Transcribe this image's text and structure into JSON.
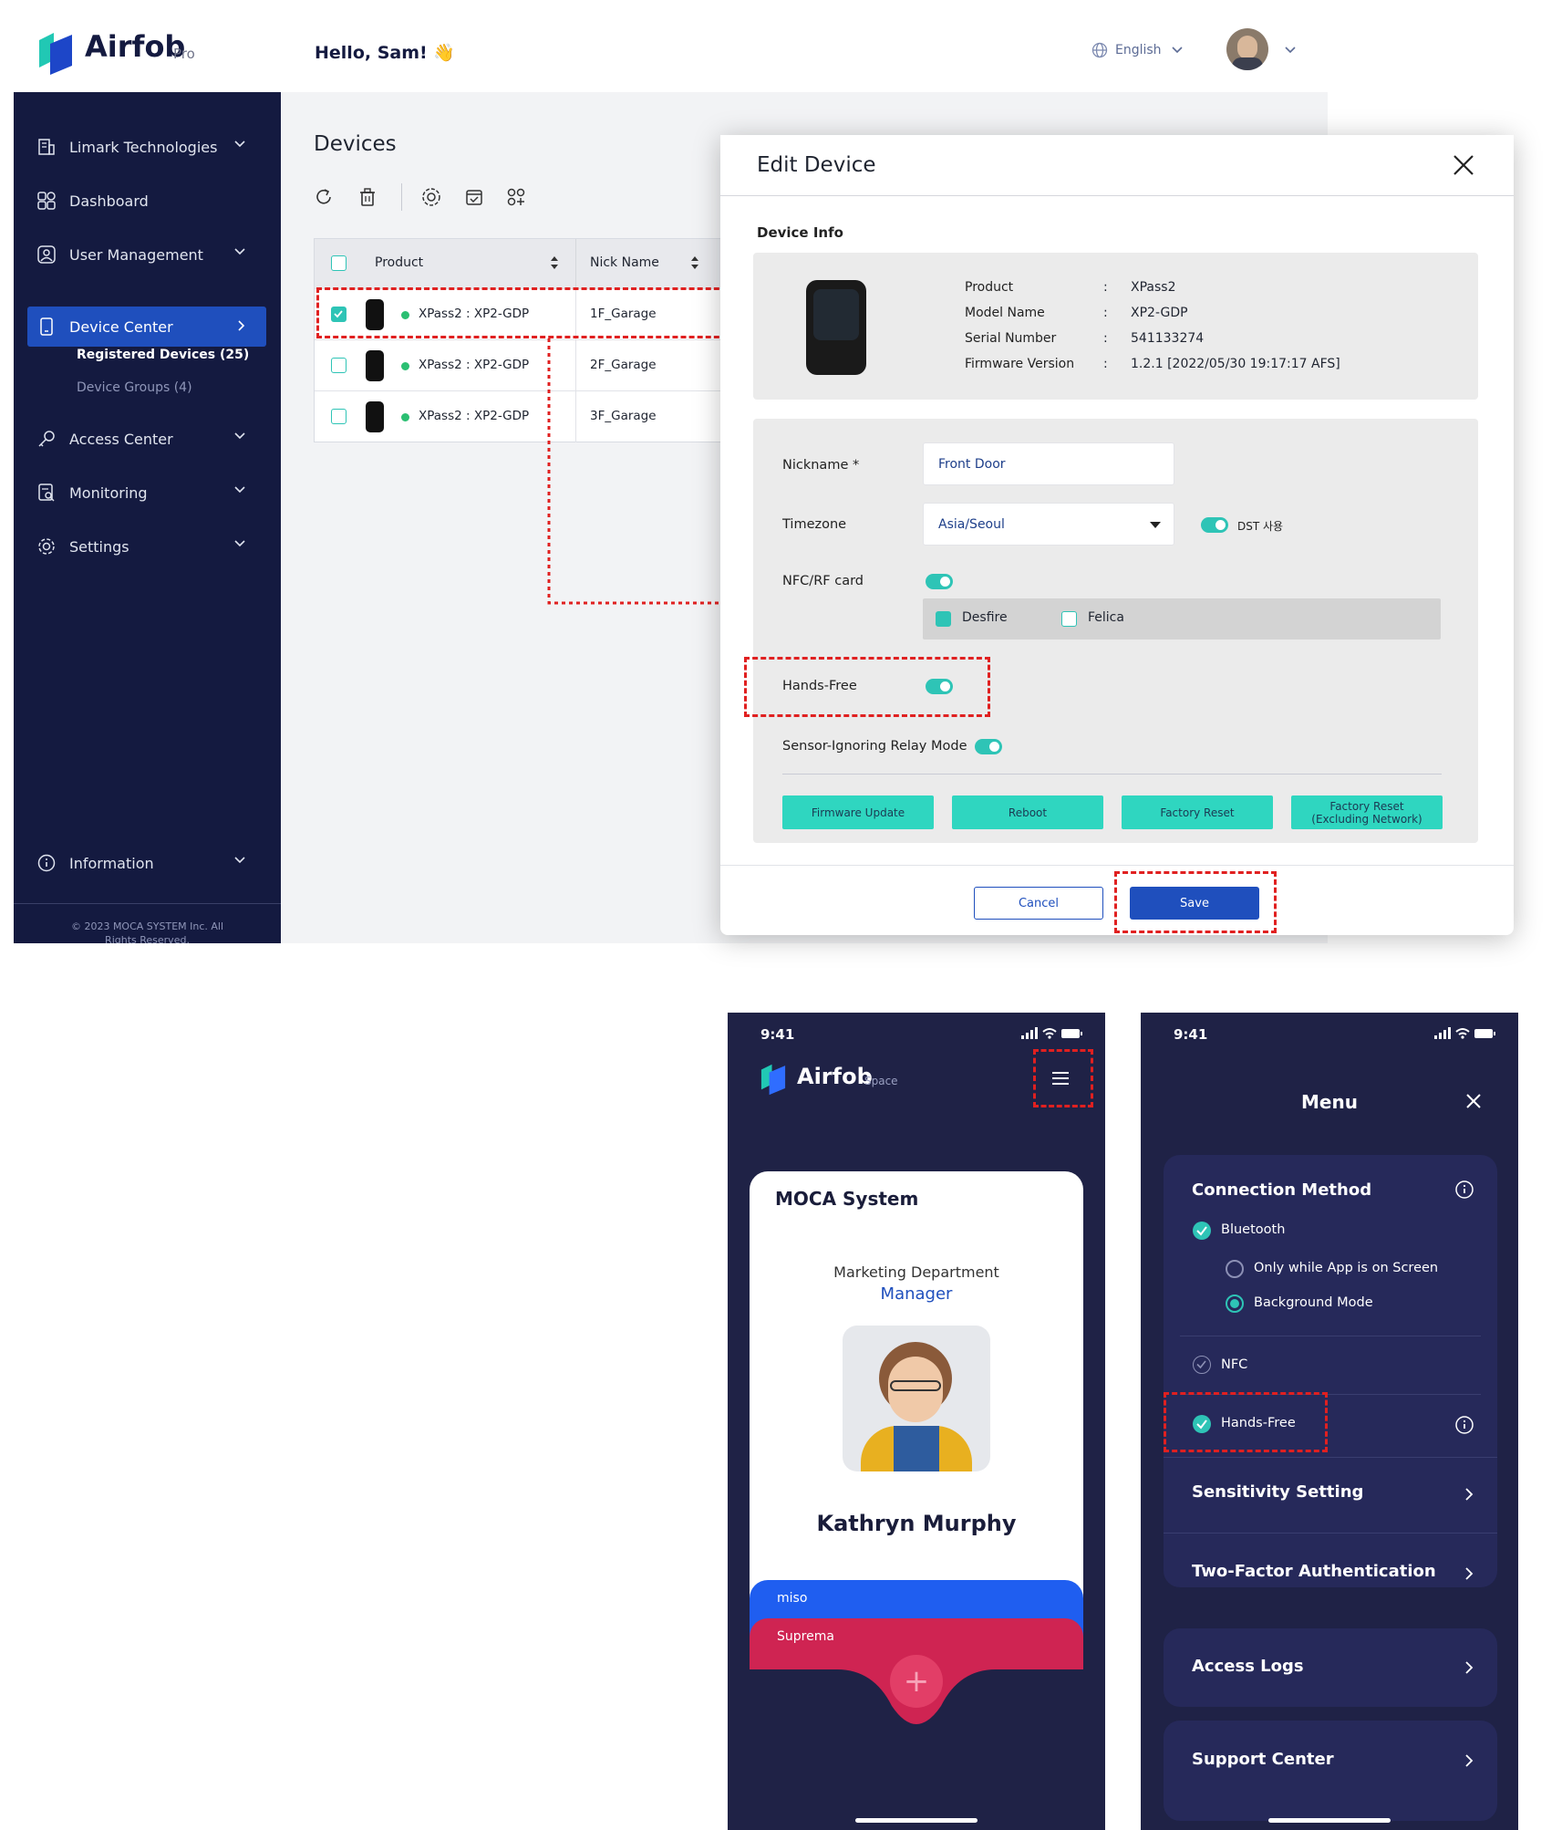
{
  "web": {
    "brand": {
      "name": "Airfob",
      "tier": "Pro"
    },
    "greeting": "Hello, Sam! 👋",
    "language": "English",
    "sidebar": {
      "items": [
        {
          "label": "Limark Technologies"
        },
        {
          "label": "Dashboard"
        },
        {
          "label": "User Management"
        },
        {
          "label": "Device Center"
        },
        {
          "label": "Access Center"
        },
        {
          "label": "Monitoring"
        },
        {
          "label": "Settings"
        },
        {
          "label": "Information"
        }
      ],
      "sub_registered": "Registered Devices (25)",
      "sub_groups": "Device Groups  (4)",
      "footer_line1": "© 2023 MOCA SYSTEM Inc. All",
      "footer_line2": "Rights Reserved."
    },
    "page_title": "Devices",
    "table": {
      "headers": [
        "Product",
        "Nick Name"
      ],
      "rows": [
        {
          "product": "XPass2 : XP2-GDP",
          "nick": "1F_Garage",
          "checked": true
        },
        {
          "product": "XPass2 : XP2-GDP",
          "nick": "2F_Garage",
          "checked": false
        },
        {
          "product": "XPass2 : XP2-GDP",
          "nick": "3F_Garage",
          "checked": false
        }
      ]
    },
    "modal": {
      "title": "Edit Device",
      "section": "Device Info",
      "info": [
        {
          "key": "Product",
          "value": "XPass2"
        },
        {
          "key": "Model Name",
          "value": "XP2-GDP"
        },
        {
          "key": "Serial Number",
          "value": "541133274"
        },
        {
          "key": "Firmware Version",
          "value": "1.2.1 [2022/05/30 19:17:17 AFS]"
        }
      ],
      "colon": ":",
      "nickname_label": "Nickname *",
      "nickname_value": "Front Door",
      "timezone_label": "Timezone",
      "timezone_value": "Asia/Seoul",
      "dst_label": "DST 사용",
      "nfc_label": "NFC/RF card",
      "desfire": "Desfire",
      "felica": "Felica",
      "handsfree_label": "Hands-Free",
      "sensor_label": "Sensor-Ignoring Relay Mode",
      "buttons": [
        "Firmware Update",
        "Reboot",
        "Factory Reset",
        "Factory Reset\n(Excluding Network)"
      ],
      "cancel": "Cancel",
      "save": "Save"
    }
  },
  "phone1": {
    "time": "9:41",
    "brand": "Airfob",
    "brand_tier": "Space",
    "company": "MOCA System",
    "department": "Marketing Department",
    "role": "Manager",
    "name": "Kathryn Murphy",
    "cards": [
      "miso",
      "Suprema"
    ],
    "add_symbol": "+"
  },
  "phone2": {
    "time": "9:41",
    "title": "Menu",
    "connection_title": "Connection Method",
    "bluetooth": "Bluetooth",
    "option1": "Only while App is on Screen",
    "option2": "Background Mode",
    "nfc": "NFC",
    "handsfree": "Hands-Free",
    "sensitivity": "Sensitivity Setting",
    "twofactor": "Two-Factor Authentication",
    "access_logs": "Access Logs",
    "support": "Support Center"
  },
  "colors": {
    "navy": "#141a40",
    "primary_blue": "#1f4fbd",
    "teal": "#2ec4b6",
    "alert_red": "#e02020",
    "phone_bg": "#1f2246",
    "card_blue": "#1f5ef0",
    "card_red": "#cf2452"
  }
}
